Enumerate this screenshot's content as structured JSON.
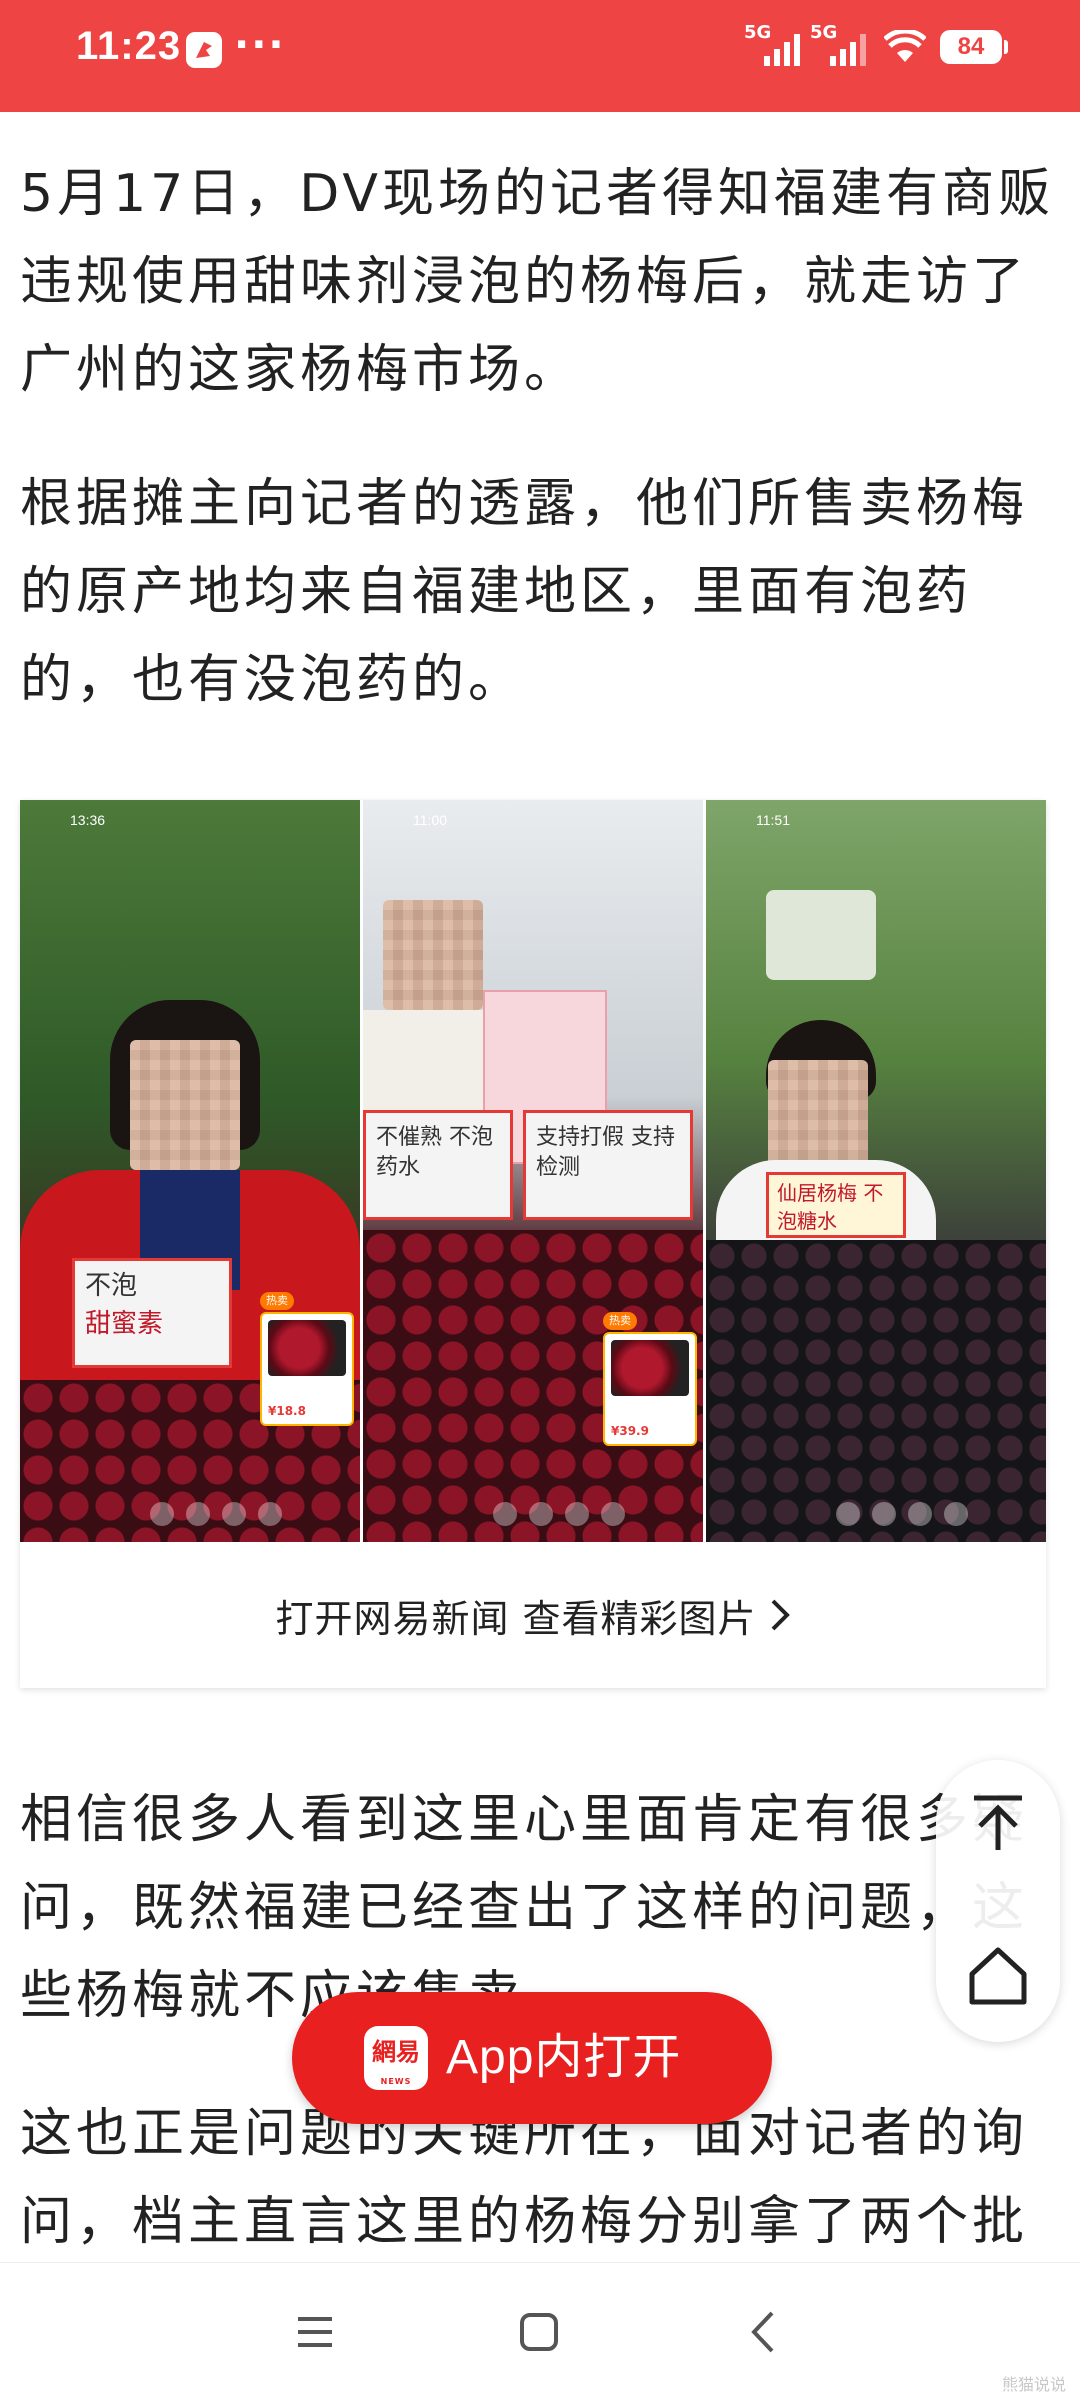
{
  "status_bar": {
    "time": "11:23",
    "dots": "···",
    "signal_1": "5G",
    "signal_2": "5G",
    "battery": "84",
    "background": "#ef4444"
  },
  "article": {
    "paragraphs": [
      "5月17日，DV现场的记者得知福建有商贩违规使用甜味剂浸泡的杨梅后，就走访了广州的这家杨梅市场。",
      "根据摊主向记者的透露，他们所售卖杨梅的原产地均来自福建地区，里面有泡药的，也有没泡药的。",
      "相信很多人看到这里心里面肯定有很多疑问，既然福建已经查出了这样的问题，这些杨梅就不应该售卖。",
      "这也正是问题的关键所在，面对记者的询问，档主直言这里的杨梅分别拿了两个批"
    ]
  },
  "image_card": {
    "caption": "打开网易新闻 查看精彩图片",
    "panels": [
      {
        "time": "13:36",
        "sign_line1": "不泡",
        "sign_line2": "甜蜜素",
        "price": "¥18.8"
      },
      {
        "time": "11:00",
        "sign_left": "不催熟 不泡药水",
        "sign_right": "支持打假 支持检测",
        "price": "¥39.9"
      },
      {
        "time": "11:51",
        "sign": "仙居杨梅 不泡糖水",
        "price": ""
      }
    ]
  },
  "floating_tools": {
    "icons": [
      "back-to-top-icon",
      "home-icon"
    ]
  },
  "open_app": {
    "logo_text": "網易",
    "logo_sub": "NEWS",
    "label": "App内打开",
    "color": "#e8201f"
  },
  "nav": {
    "icons": [
      "menu-icon",
      "home-square-icon",
      "back-chevron-icon"
    ]
  },
  "watermark": "熊猫说说"
}
